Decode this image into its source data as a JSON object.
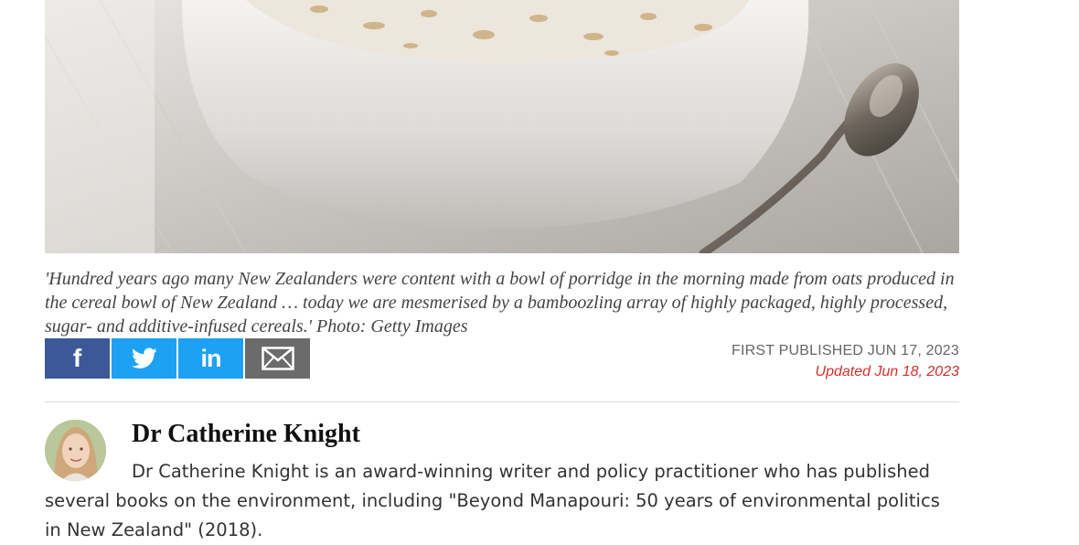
{
  "photo": {
    "subject": "bowl of porridge with spoon"
  },
  "caption": {
    "text": "'Hundred years ago many New Zealanders were content with a bowl of porridge in the morning made from oats produced in the cereal bowl of New Zealand … today we are mesmerised by a bamboozling array of highly packaged, highly processed, sugar- and additive-infused cereals.' Photo: Getty Images"
  },
  "share": {
    "facebook_icon": "facebook-icon",
    "twitter_icon": "twitter-icon",
    "linkedin_icon": "linkedin-icon",
    "email_icon": "envelope-icon",
    "colors": {
      "facebook": "#3b5998",
      "twitter": "#1da1f2",
      "linkedin": "#1da1f2",
      "email": "#6b6b6b"
    }
  },
  "dates": {
    "first_published": "FIRST PUBLISHED JUN 17, 2023",
    "updated": "Updated Jun 18, 2023"
  },
  "author": {
    "name": "Dr Catherine Knight",
    "bio": "Dr Catherine Knight is an award-winning writer and policy practitioner who has published several books on the environment, including \"Beyond Manapouri: 50 years of environmental politics in New Zealand\" (2018)."
  }
}
